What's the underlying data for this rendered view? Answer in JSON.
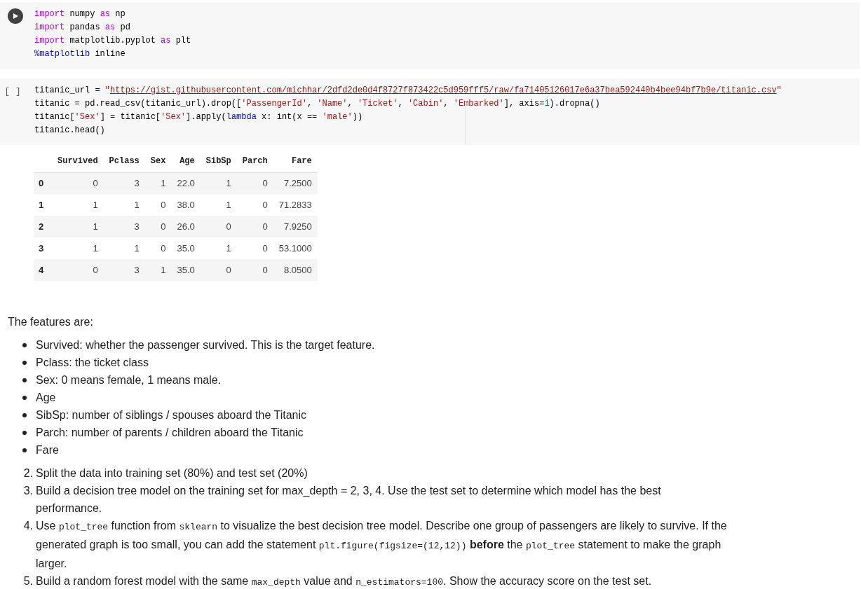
{
  "cells": [
    {
      "kind": "code",
      "executed": true,
      "lines": [
        [
          {
            "kind": "keyword",
            "text": "import"
          },
          {
            "kind": "plain",
            "text": " numpy "
          },
          {
            "kind": "keyword",
            "text": "as"
          },
          {
            "kind": "plain",
            "text": " np"
          }
        ],
        [
          {
            "kind": "keyword",
            "text": "import"
          },
          {
            "kind": "plain",
            "text": " pandas "
          },
          {
            "kind": "keyword",
            "text": "as"
          },
          {
            "kind": "plain",
            "text": " pd"
          }
        ],
        [
          {
            "kind": "keyword",
            "text": "import"
          },
          {
            "kind": "plain",
            "text": " matplotlib.pyplot "
          },
          {
            "kind": "keyword",
            "text": "as"
          },
          {
            "kind": "plain",
            "text": " plt"
          }
        ],
        [
          {
            "kind": "magic",
            "text": "%matplotlib"
          },
          {
            "kind": "plain",
            "text": " inline"
          }
        ]
      ]
    },
    {
      "kind": "code",
      "executed": false,
      "run_label": "[ ]",
      "lines": [
        [
          {
            "kind": "plain",
            "text": "titanic_url = "
          },
          {
            "kind": "string",
            "text": "\""
          },
          {
            "kind": "link",
            "text": "https://gist.githubusercontent.com/michhar/2dfd2de0d4f8727f873422c5d959fff5/raw/fa71405126017e6a37bea592440b4bee94bf7b9e/titanic.csv"
          },
          {
            "kind": "string",
            "text": "\""
          }
        ],
        [
          {
            "kind": "plain",
            "text": "titanic = pd.read_csv(titanic_url).drop(["
          },
          {
            "kind": "string",
            "text": "'PassengerId'"
          },
          {
            "kind": "plain",
            "text": ", "
          },
          {
            "kind": "string",
            "text": "'Name'"
          },
          {
            "kind": "plain",
            "text": ", "
          },
          {
            "kind": "string",
            "text": "'Ticket'"
          },
          {
            "kind": "plain",
            "text": ", "
          },
          {
            "kind": "string",
            "text": "'Cabin'"
          },
          {
            "kind": "plain",
            "text": ", "
          },
          {
            "kind": "string",
            "text": "'Embarked'"
          },
          {
            "kind": "plain",
            "text": "], axis="
          },
          {
            "kind": "number",
            "text": "1"
          },
          {
            "kind": "plain",
            "text": ").dropna()"
          }
        ],
        [
          {
            "kind": "plain",
            "text": "titanic["
          },
          {
            "kind": "string",
            "text": "'Sex'"
          },
          {
            "kind": "plain",
            "text": "] = titanic["
          },
          {
            "kind": "string",
            "text": "'Sex'"
          },
          {
            "kind": "plain",
            "text": "].apply("
          },
          {
            "kind": "magic",
            "text": "lambda"
          },
          {
            "kind": "plain",
            "text": " x: int(x == "
          },
          {
            "kind": "string",
            "text": "'male'"
          },
          {
            "kind": "plain",
            "text": "))"
          }
        ],
        [
          {
            "kind": "plain",
            "text": "titanic.head()"
          }
        ]
      ],
      "output": {
        "table": {
          "columns": [
            "Survived",
            "Pclass",
            "Sex",
            "Age",
            "SibSp",
            "Parch",
            "Fare"
          ],
          "rows": [
            {
              "index": "0",
              "cells": [
                "0",
                "3",
                "1",
                "22.0",
                "1",
                "0",
                "7.2500"
              ]
            },
            {
              "index": "1",
              "cells": [
                "1",
                "1",
                "0",
                "38.0",
                "1",
                "0",
                "71.2833"
              ]
            },
            {
              "index": "2",
              "cells": [
                "1",
                "3",
                "0",
                "26.0",
                "0",
                "0",
                "7.9250"
              ]
            },
            {
              "index": "3",
              "cells": [
                "1",
                "1",
                "0",
                "35.0",
                "1",
                "0",
                "53.1000"
              ]
            },
            {
              "index": "4",
              "cells": [
                "0",
                "3",
                "1",
                "35.0",
                "0",
                "0",
                "8.0500"
              ]
            }
          ]
        }
      }
    },
    {
      "kind": "text",
      "intro": "The features are:",
      "bullets": [
        "Survived: whether the passenger survived. This is the target feature.",
        "Pclass: the ticket class",
        "Sex: 0 means female, 1 means male.",
        "Age",
        "SibSp: number of siblings / spouses aboard the Titanic",
        "Parch: number of parents / children aboard the Titanic",
        "Fare"
      ],
      "numbered": [
        {
          "number": "2.",
          "parts": [
            {
              "kind": "text",
              "text": "Split the data into training set (80%) and test set (20%)"
            }
          ]
        },
        {
          "number": "3.",
          "parts": [
            {
              "kind": "text",
              "text": "Build a decision tree model on the training set for max_depth = 2, 3, 4. Use the test set to determine which model has the best performance."
            }
          ]
        },
        {
          "number": "4.",
          "parts": [
            {
              "kind": "text",
              "text": "Use "
            },
            {
              "kind": "code",
              "text": "plot_tree"
            },
            {
              "kind": "text",
              "text": " function from "
            },
            {
              "kind": "code",
              "text": "sklearn"
            },
            {
              "kind": "text",
              "text": " to visualize the best decision tree model. Describe one group of passengers are likely to survive. If the generated graph is too small, you can add the statement "
            },
            {
              "kind": "code",
              "text": "plt.figure(figsize=(12,12))"
            },
            {
              "kind": "bold",
              "text": " before"
            },
            {
              "kind": "text",
              "text": " the "
            },
            {
              "kind": "code",
              "text": "plot_tree"
            },
            {
              "kind": "text",
              "text": " statement to make the graph larger."
            }
          ]
        },
        {
          "number": "5.",
          "parts": [
            {
              "kind": "text",
              "text": "Build a random forest model with the same "
            },
            {
              "kind": "code",
              "text": "max_depth"
            },
            {
              "kind": "text",
              "text": " value and "
            },
            {
              "kind": "code",
              "text": "n_estimators=100"
            },
            {
              "kind": "text",
              "text": ". Show the accuracy score on the test set."
            }
          ]
        }
      ]
    }
  ]
}
